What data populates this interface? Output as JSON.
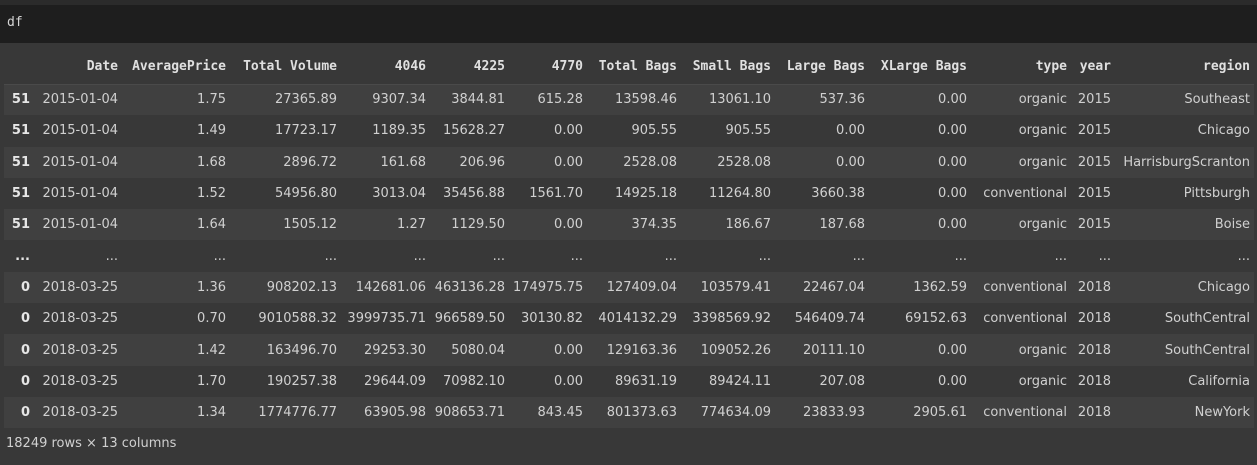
{
  "cell": {
    "code": "df"
  },
  "table": {
    "index_header": "",
    "columns": [
      "Date",
      "AveragePrice",
      "Total Volume",
      "4046",
      "4225",
      "4770",
      "Total Bags",
      "Small Bags",
      "Large Bags",
      "XLarge Bags",
      "type",
      "year",
      "region"
    ],
    "rows": [
      {
        "index": "51",
        "cells": [
          "2015-01-04",
          "1.75",
          "27365.89",
          "9307.34",
          "3844.81",
          "615.28",
          "13598.46",
          "13061.10",
          "537.36",
          "0.00",
          "organic",
          "2015",
          "Southeast"
        ]
      },
      {
        "index": "51",
        "cells": [
          "2015-01-04",
          "1.49",
          "17723.17",
          "1189.35",
          "15628.27",
          "0.00",
          "905.55",
          "905.55",
          "0.00",
          "0.00",
          "organic",
          "2015",
          "Chicago"
        ]
      },
      {
        "index": "51",
        "cells": [
          "2015-01-04",
          "1.68",
          "2896.72",
          "161.68",
          "206.96",
          "0.00",
          "2528.08",
          "2528.08",
          "0.00",
          "0.00",
          "organic",
          "2015",
          "HarrisburgScranton"
        ]
      },
      {
        "index": "51",
        "cells": [
          "2015-01-04",
          "1.52",
          "54956.80",
          "3013.04",
          "35456.88",
          "1561.70",
          "14925.18",
          "11264.80",
          "3660.38",
          "0.00",
          "conventional",
          "2015",
          "Pittsburgh"
        ]
      },
      {
        "index": "51",
        "cells": [
          "2015-01-04",
          "1.64",
          "1505.12",
          "1.27",
          "1129.50",
          "0.00",
          "374.35",
          "186.67",
          "187.68",
          "0.00",
          "organic",
          "2015",
          "Boise"
        ]
      },
      {
        "index": "...",
        "cells": [
          "...",
          "...",
          "...",
          "...",
          "...",
          "...",
          "...",
          "...",
          "...",
          "...",
          "...",
          "...",
          "..."
        ]
      },
      {
        "index": "0",
        "cells": [
          "2018-03-25",
          "1.36",
          "908202.13",
          "142681.06",
          "463136.28",
          "174975.75",
          "127409.04",
          "103579.41",
          "22467.04",
          "1362.59",
          "conventional",
          "2018",
          "Chicago"
        ]
      },
      {
        "index": "0",
        "cells": [
          "2018-03-25",
          "0.70",
          "9010588.32",
          "3999735.71",
          "966589.50",
          "30130.82",
          "4014132.29",
          "3398569.92",
          "546409.74",
          "69152.63",
          "conventional",
          "2018",
          "SouthCentral"
        ]
      },
      {
        "index": "0",
        "cells": [
          "2018-03-25",
          "1.42",
          "163496.70",
          "29253.30",
          "5080.04",
          "0.00",
          "129163.36",
          "109052.26",
          "20111.10",
          "0.00",
          "organic",
          "2018",
          "SouthCentral"
        ]
      },
      {
        "index": "0",
        "cells": [
          "2018-03-25",
          "1.70",
          "190257.38",
          "29644.09",
          "70982.10",
          "0.00",
          "89631.19",
          "89424.11",
          "207.08",
          "0.00",
          "organic",
          "2018",
          "California"
        ]
      },
      {
        "index": "0",
        "cells": [
          "2018-03-25",
          "1.34",
          "1774776.77",
          "63905.98",
          "908653.71",
          "843.45",
          "801373.63",
          "774634.09",
          "23833.93",
          "2905.61",
          "conventional",
          "2018",
          "NewYork"
        ]
      }
    ]
  },
  "footer": {
    "shape_text": "18249 rows × 13 columns"
  }
}
